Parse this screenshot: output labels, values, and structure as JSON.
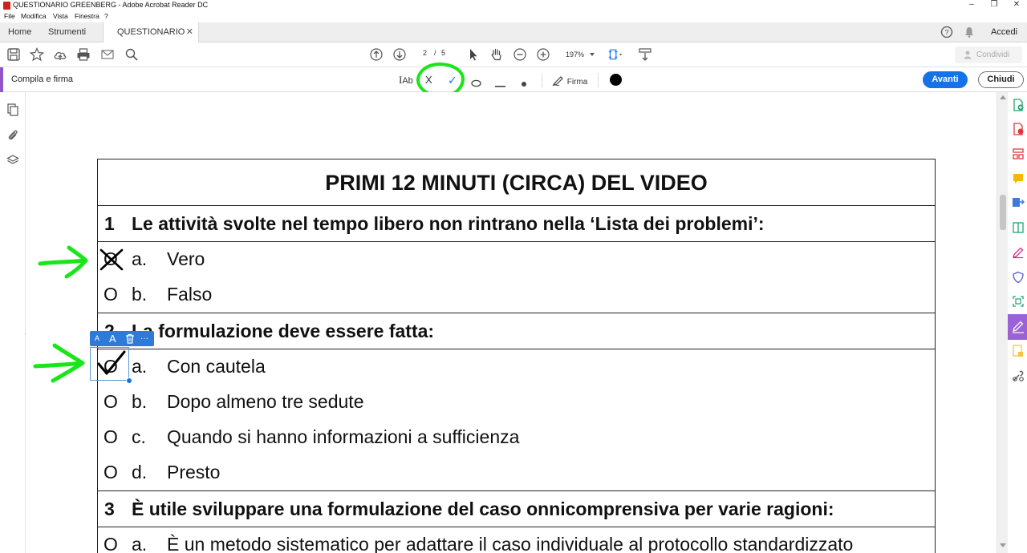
{
  "window": {
    "title": "QUESTIONARIO GREENBERG - Adobe Acrobat Reader DC",
    "minimize": "–",
    "restore": "❐",
    "close": "✕"
  },
  "menu": [
    "File",
    "Modifica",
    "Vista",
    "Finestra",
    "?"
  ],
  "tabs": {
    "home": "Home",
    "tools": "Strumenti",
    "document": "QUESTIONARIO G...",
    "close": "✕",
    "sign_in": "Accedi"
  },
  "toolbar": {
    "page_current": "2",
    "page_sep": "/",
    "page_total": "5",
    "zoom": "197%",
    "share": "Condividi"
  },
  "fill_sign": {
    "label": "Compila e firma",
    "text_tool": "Ab",
    "cross_tool": "X",
    "check_tool": "✓",
    "sign_label": "Firma",
    "next": "Avanti",
    "close": "Chiudi",
    "selected_color": "#000000"
  },
  "document": {
    "title": "PRIMI 12 MINUTI (CIRCA) DEL VIDEO",
    "questions": [
      {
        "number": "1",
        "text": "Le attività svolte nel tempo libero non rintrano nella ‘Lista dei problemi’:",
        "options": [
          {
            "circle": "O",
            "letter": "a.",
            "text": "Vero"
          },
          {
            "circle": "O",
            "letter": "b.",
            "text": "Falso"
          }
        ]
      },
      {
        "number": "2",
        "text": "La formulazione deve essere fatta:",
        "options": [
          {
            "circle": "O",
            "letter": "a.",
            "text": "Con cautela"
          },
          {
            "circle": "O",
            "letter": "b.",
            "text": "Dopo almeno tre sedute"
          },
          {
            "circle": "O",
            "letter": "c.",
            "text": "Quando si hanno informazioni a sufficienza"
          },
          {
            "circle": "O",
            "letter": "d.",
            "text": "Presto"
          }
        ]
      },
      {
        "number": "3",
        "text": "È utile sviluppare una formulazione del caso onnicomprensiva per varie ragioni:",
        "options": [
          {
            "circle": "O",
            "letter": "a.",
            "text": "È un metodo sistematico per adattare il caso individuale al protocollo standardizzato"
          }
        ]
      }
    ]
  },
  "mini_toolbar": {
    "small_a": "A",
    "large_a": "A",
    "more": "···"
  },
  "colors": {
    "accent": "#1473e6",
    "fill_sign_accent": "#8f55c9",
    "annotation_green": "#19e619"
  }
}
